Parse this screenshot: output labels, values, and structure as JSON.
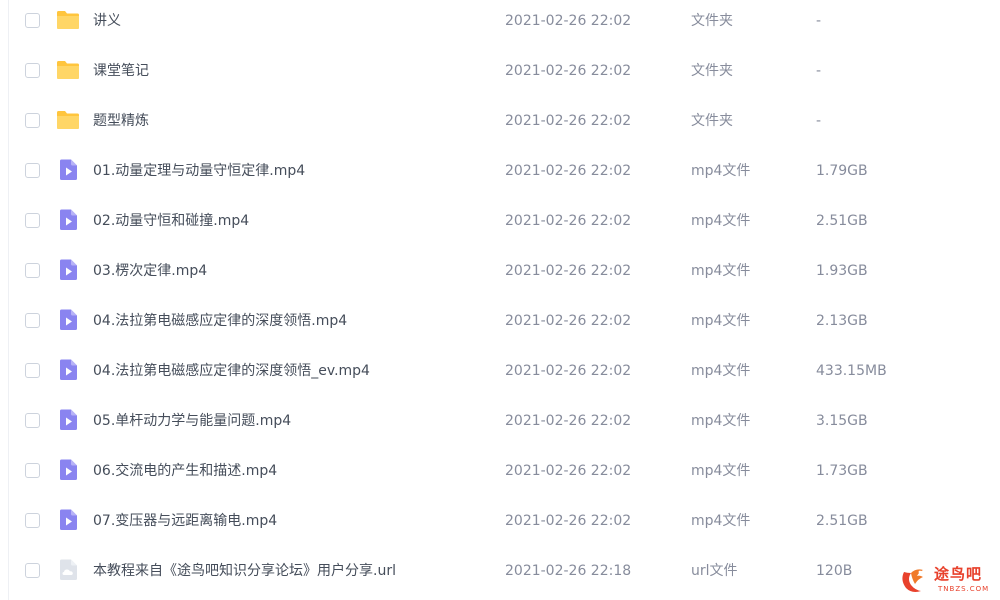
{
  "files": [
    {
      "kind": "folder",
      "icon": "folder-icon",
      "name": "讲义",
      "date": "2021-02-26 22:02",
      "type": "文件夹",
      "size": "-"
    },
    {
      "kind": "folder",
      "icon": "folder-icon",
      "name": "课堂笔记",
      "date": "2021-02-26 22:02",
      "type": "文件夹",
      "size": "-"
    },
    {
      "kind": "folder",
      "icon": "folder-icon",
      "name": "题型精炼",
      "date": "2021-02-26 22:02",
      "type": "文件夹",
      "size": "-"
    },
    {
      "kind": "video",
      "icon": "video-file-icon",
      "name": "01.动量定理与动量守恒定律.mp4",
      "date": "2021-02-26 22:02",
      "type": "mp4文件",
      "size": "1.79GB"
    },
    {
      "kind": "video",
      "icon": "video-file-icon",
      "name": "02.动量守恒和碰撞.mp4",
      "date": "2021-02-26 22:02",
      "type": "mp4文件",
      "size": "2.51GB"
    },
    {
      "kind": "video",
      "icon": "video-file-icon",
      "name": "03.楞次定律.mp4",
      "date": "2021-02-26 22:02",
      "type": "mp4文件",
      "size": "1.93GB"
    },
    {
      "kind": "video",
      "icon": "video-file-icon",
      "name": "04.法拉第电磁感应定律的深度领悟.mp4",
      "date": "2021-02-26 22:02",
      "type": "mp4文件",
      "size": "2.13GB"
    },
    {
      "kind": "video",
      "icon": "video-file-icon",
      "name": "04.法拉第电磁感应定律的深度领悟_ev.mp4",
      "date": "2021-02-26 22:02",
      "type": "mp4文件",
      "size": "433.15MB"
    },
    {
      "kind": "video",
      "icon": "video-file-icon",
      "name": "05.单杆动力学与能量问题.mp4",
      "date": "2021-02-26 22:02",
      "type": "mp4文件",
      "size": "3.15GB"
    },
    {
      "kind": "video",
      "icon": "video-file-icon",
      "name": "06.交流电的产生和描述.mp4",
      "date": "2021-02-26 22:02",
      "type": "mp4文件",
      "size": "1.73GB"
    },
    {
      "kind": "video",
      "icon": "video-file-icon",
      "name": "07.变压器与远距离输电.mp4",
      "date": "2021-02-26 22:02",
      "type": "mp4文件",
      "size": "2.51GB"
    },
    {
      "kind": "url",
      "icon": "link-file-icon",
      "name": "本教程来自《途鸟吧知识分享论坛》用户分享.url",
      "date": "2021-02-26 22:18",
      "type": "url文件",
      "size": "120B"
    }
  ],
  "watermark": {
    "text": "途鸟吧",
    "subtext": "TNBZS.COM",
    "color": "#e8412c"
  },
  "colors": {
    "folder": "#ffc53d",
    "video": "#8a84f0",
    "link": "#dfe3ea",
    "checkbox_border": "#cdd3dd"
  }
}
